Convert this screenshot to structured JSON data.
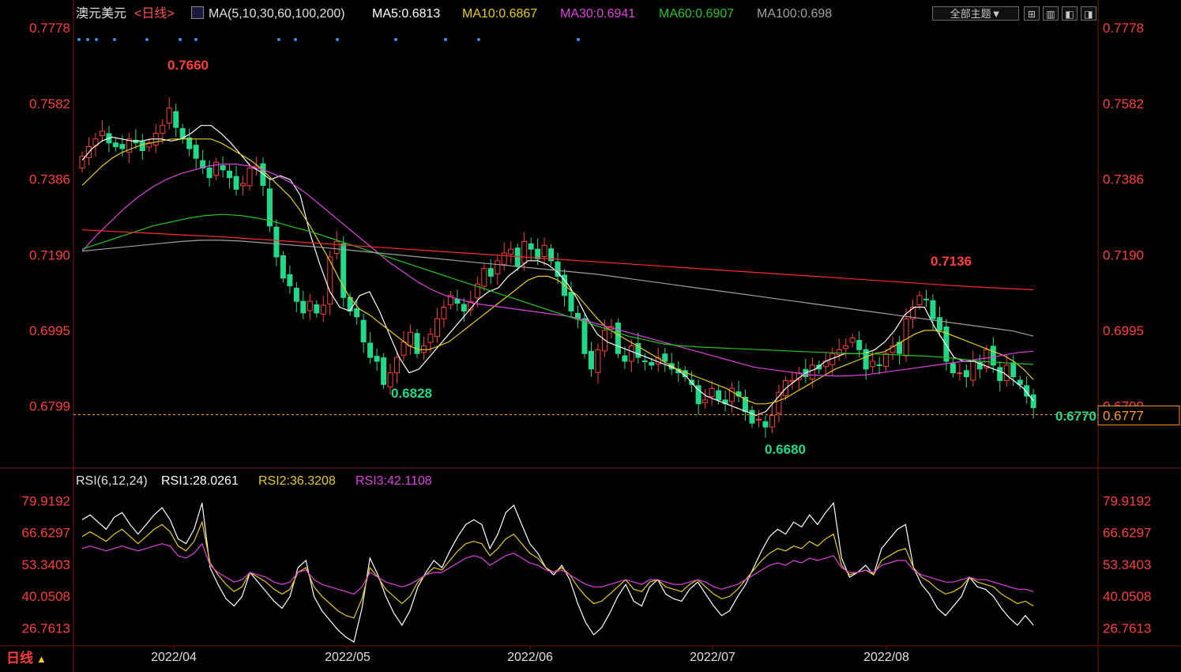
{
  "header": {
    "instrument": "澳元美元",
    "period": "<日线>",
    "ma_label": "MA(5,10,30,60,100,200)",
    "ma5": "MA5:0.6813",
    "ma10": "MA10:0.6867",
    "ma30": "MA30:0.6941",
    "ma60": "MA60:0.6907",
    "ma100": "MA100:0.698",
    "theme_button": "全部主题▼"
  },
  "rsi_header": {
    "label": "RSI(6,12,24)",
    "rsi1": "RSI1:28.0261",
    "rsi2": "RSI2:36.3208",
    "rsi3": "RSI3:42.1108"
  },
  "footer": {
    "period_badge": "日线",
    "badge_arrow": "▲"
  },
  "colors": {
    "background": "#000000",
    "up": "#ff3c3c",
    "down": "#22d98a",
    "ma5": "#ffffff",
    "ma10": "#e6cc1a",
    "ma30": "#e040e0",
    "ma60": "#22c422",
    "ma100": "#a0a0a0",
    "ma200": "#ff2a2a",
    "grid": "#7a1414",
    "axis_text": "#ff3c3c"
  },
  "chart_data": [
    {
      "type": "candlestick",
      "title": "",
      "y_ticks": [
        "0.7778",
        "0.7582",
        "0.7386",
        "0.7190",
        "0.6995",
        "0.6799"
      ],
      "ylim": [
        0.6645,
        0.7778
      ],
      "x_ticks": [
        "2022/04",
        "2022/05",
        "2022/06",
        "2022/07",
        "2022/08"
      ],
      "annotations": {
        "high": "0.7660",
        "low_may": "0.6828",
        "low_jul": "0.6680",
        "high_aug": "0.7136",
        "last_low": "0.6770",
        "current_price": "0.6777"
      },
      "current_price": 0.6777,
      "close_series": [
        0.7445,
        0.747,
        0.749,
        0.751,
        0.748,
        0.747,
        0.7465,
        0.749,
        0.748,
        0.746,
        0.748,
        0.7505,
        0.7525,
        0.757,
        0.752,
        0.749,
        0.7465,
        0.744,
        0.7415,
        0.739,
        0.743,
        0.741,
        0.739,
        0.736,
        0.7375,
        0.7415,
        0.742,
        0.737,
        0.7265,
        0.7185,
        0.713,
        0.711,
        0.707,
        0.704,
        0.707,
        0.704,
        0.706,
        0.7185,
        0.7225,
        0.708,
        0.7045,
        0.703,
        0.6965,
        0.6925,
        0.6915,
        0.6855,
        0.6885,
        0.6925,
        0.6965,
        0.699,
        0.6935,
        0.6955,
        0.6985,
        0.7025,
        0.7055,
        0.7085,
        0.7065,
        0.7045,
        0.707,
        0.7115,
        0.7155,
        0.7135,
        0.7175,
        0.7195,
        0.7205,
        0.716,
        0.7225,
        0.7205,
        0.718,
        0.7215,
        0.7175,
        0.7135,
        0.7085,
        0.7045,
        0.7025,
        0.6935,
        0.6895,
        0.6945,
        0.6995,
        0.7005,
        0.6935,
        0.6915,
        0.6955,
        0.6925,
        0.6915,
        0.6905,
        0.6925,
        0.6915,
        0.6895,
        0.6885,
        0.6875,
        0.6855,
        0.6805,
        0.6815,
        0.6845,
        0.6815,
        0.6805,
        0.6845,
        0.6825,
        0.6785,
        0.6755,
        0.6765,
        0.6745,
        0.6775,
        0.6835,
        0.6865,
        0.6865,
        0.6885,
        0.6875,
        0.6905,
        0.6895,
        0.6915,
        0.6935,
        0.6945,
        0.6955,
        0.6975,
        0.6945,
        0.6895,
        0.6915,
        0.6905,
        0.6935,
        0.6955,
        0.6935,
        0.7025,
        0.7055,
        0.7085,
        0.7075,
        0.7025,
        0.6995,
        0.6915,
        0.6885,
        0.6885,
        0.6875,
        0.6915,
        0.6895,
        0.6945,
        0.6905,
        0.6865,
        0.6905,
        0.6875,
        0.6855,
        0.6825,
        0.6795
      ],
      "series": [
        {
          "name": "MA5",
          "values": [
            0.7435,
            0.7465,
            0.7485,
            0.7495,
            0.749,
            0.7485,
            0.7485,
            0.749,
            0.749,
            0.7485,
            0.749,
            0.7505,
            0.7525,
            0.7525,
            0.7505,
            0.748,
            0.745,
            0.742,
            0.7405,
            0.7385,
            0.7395,
            0.7385,
            0.7345,
            0.7245,
            0.7165,
            0.7095,
            0.7055,
            0.7045,
            0.7085,
            0.7095,
            0.7045,
            0.6985,
            0.6925,
            0.6885,
            0.6895,
            0.6925,
            0.6955,
            0.6985,
            0.7015,
            0.7045,
            0.7075,
            0.7095,
            0.7105,
            0.7135,
            0.7155,
            0.7175,
            0.7175,
            0.7165,
            0.7145,
            0.7115,
            0.7075,
            0.7025,
            0.6985,
            0.6965,
            0.6955,
            0.6945,
            0.6935,
            0.6925,
            0.6915,
            0.6905,
            0.6895,
            0.6875,
            0.6845,
            0.6825,
            0.6815,
            0.6805,
            0.6795,
            0.6785,
            0.6775,
            0.6785,
            0.6815,
            0.6845,
            0.6865,
            0.6885,
            0.6895,
            0.6915,
            0.6925,
            0.6935,
            0.6935,
            0.6935,
            0.6945,
            0.6965,
            0.6995,
            0.7035,
            0.7055,
            0.7055,
            0.7005,
            0.6965,
            0.6925,
            0.6915,
            0.6915,
            0.6905,
            0.6895,
            0.6885,
            0.6865,
            0.6845,
            0.6813
          ]
        },
        {
          "name": "MA10",
          "values": [
            0.737,
            0.7395,
            0.742,
            0.744,
            0.7455,
            0.7465,
            0.7475,
            0.748,
            0.7485,
            0.749,
            0.749,
            0.749,
            0.749,
            0.749,
            0.748,
            0.7465,
            0.745,
            0.7435,
            0.7415,
            0.739,
            0.7365,
            0.734,
            0.7305,
            0.7265,
            0.722,
            0.7175,
            0.7125,
            0.708,
            0.705,
            0.7035,
            0.7015,
            0.6995,
            0.6975,
            0.6955,
            0.6945,
            0.6945,
            0.6955,
            0.6965,
            0.6985,
            0.7005,
            0.7025,
            0.7045,
            0.7065,
            0.7085,
            0.7105,
            0.7125,
            0.7135,
            0.7135,
            0.7125,
            0.7105,
            0.7085,
            0.7055,
            0.7025,
            0.7,
            0.6985,
            0.697,
            0.6955,
            0.694,
            0.6925,
            0.691,
            0.6895,
            0.6885,
            0.6875,
            0.6865,
            0.6855,
            0.6845,
            0.683,
            0.6815,
            0.6805,
            0.6805,
            0.681,
            0.682,
            0.6835,
            0.685,
            0.6865,
            0.688,
            0.6895,
            0.6905,
            0.6915,
            0.6925,
            0.6935,
            0.694,
            0.6955,
            0.697,
            0.6985,
            0.6995,
            0.6995,
            0.699,
            0.698,
            0.697,
            0.696,
            0.695,
            0.694,
            0.693,
            0.6915,
            0.6895,
            0.6867
          ]
        },
        {
          "name": "MA30",
          "values": [
            0.72,
            0.724,
            0.7275,
            0.731,
            0.734,
            0.7365,
            0.7385,
            0.74,
            0.741,
            0.742,
            0.7425,
            0.7425,
            0.742,
            0.741,
            0.7395,
            0.7375,
            0.735,
            0.732,
            0.729,
            0.726,
            0.723,
            0.72,
            0.717,
            0.7145,
            0.712,
            0.71,
            0.7085,
            0.7075,
            0.7065,
            0.706,
            0.7055,
            0.705,
            0.7045,
            0.704,
            0.7035,
            0.703,
            0.702,
            0.701,
            0.7,
            0.699,
            0.698,
            0.697,
            0.696,
            0.695,
            0.694,
            0.693,
            0.692,
            0.691,
            0.69,
            0.6895,
            0.689,
            0.6885,
            0.688,
            0.6878,
            0.6877,
            0.6878,
            0.688,
            0.6885,
            0.689,
            0.6895,
            0.69,
            0.6905,
            0.691,
            0.6915,
            0.692,
            0.6925,
            0.6932,
            0.6938,
            0.6941
          ]
        },
        {
          "name": "MA60",
          "values": [
            0.7205,
            0.722,
            0.7235,
            0.725,
            0.7265,
            0.7275,
            0.7285,
            0.7292,
            0.7295,
            0.7292,
            0.7285,
            0.7275,
            0.7262,
            0.725,
            0.7235,
            0.722,
            0.7205,
            0.719,
            0.7175,
            0.716,
            0.7145,
            0.713,
            0.7115,
            0.71,
            0.7085,
            0.707,
            0.7055,
            0.704,
            0.7025,
            0.701,
            0.6995,
            0.698,
            0.697,
            0.696,
            0.6955,
            0.6952,
            0.695,
            0.6948,
            0.6946,
            0.6944,
            0.6942,
            0.694,
            0.6938,
            0.6936,
            0.6935,
            0.6934,
            0.6932,
            0.693,
            0.6928,
            0.6925,
            0.692,
            0.6915,
            0.6912,
            0.6909,
            0.6907
          ]
        },
        {
          "name": "MA100",
          "values": [
            0.72,
            0.7205,
            0.721,
            0.7215,
            0.722,
            0.7225,
            0.7228,
            0.7228,
            0.7226,
            0.7222,
            0.7218,
            0.7214,
            0.721,
            0.7205,
            0.72,
            0.7195,
            0.719,
            0.7185,
            0.718,
            0.7175,
            0.717,
            0.7165,
            0.716,
            0.7155,
            0.715,
            0.7145,
            0.714,
            0.7133,
            0.7126,
            0.7119,
            0.7112,
            0.7105,
            0.7098,
            0.7091,
            0.7084,
            0.7077,
            0.707,
            0.7063,
            0.7056,
            0.7049,
            0.7042,
            0.7035,
            0.7028,
            0.7021,
            0.7014,
            0.7007,
            0.7,
            0.6993,
            0.698
          ]
        },
        {
          "name": "MA200",
          "values": [
            0.7255,
            0.7252,
            0.7249,
            0.7246,
            0.7243,
            0.724,
            0.7237,
            0.7233,
            0.7229,
            0.7225,
            0.7221,
            0.7217,
            0.7213,
            0.7209,
            0.7205,
            0.7201,
            0.7197,
            0.7193,
            0.7189,
            0.7185,
            0.7181,
            0.7177,
            0.7173,
            0.7169,
            0.7165,
            0.7161,
            0.7157,
            0.7153,
            0.7149,
            0.7145,
            0.7141,
            0.7137,
            0.7133,
            0.7129,
            0.7125,
            0.7121,
            0.7117,
            0.7113,
            0.7109,
            0.7106,
            0.7103,
            0.71
          ]
        }
      ]
    },
    {
      "type": "line",
      "title": "",
      "y_ticks": [
        "79.9192",
        "66.6297",
        "53.3403",
        "40.0508",
        "26.7613"
      ],
      "ylim": [
        20.0,
        85.0
      ],
      "series": [
        {
          "name": "RSI1",
          "values": [
            72,
            74,
            71,
            68,
            73,
            75,
            70,
            66,
            70,
            74,
            77,
            72,
            64,
            62,
            68,
            79,
            52,
            45,
            39,
            36,
            40,
            50,
            46,
            42,
            38,
            35,
            40,
            52,
            55,
            40,
            34,
            30,
            26,
            23,
            21,
            35,
            56,
            49,
            40,
            33,
            28,
            34,
            44,
            50,
            55,
            52,
            59,
            65,
            70,
            72,
            70,
            60,
            66,
            75,
            78,
            70,
            62,
            58,
            52,
            49,
            53,
            47,
            37,
            29,
            24,
            27,
            33,
            40,
            45,
            38,
            36,
            44,
            47,
            41,
            39,
            38,
            43,
            46,
            41,
            36,
            32,
            34,
            40,
            45,
            52,
            59,
            65,
            68,
            66,
            71,
            69,
            74,
            70,
            75,
            79,
            56,
            48,
            50,
            53,
            49,
            60,
            64,
            68,
            70,
            52,
            45,
            41,
            35,
            32,
            36,
            40,
            48,
            44,
            43,
            40,
            35,
            31,
            28,
            32,
            28
          ]
        },
        {
          "name": "RSI2",
          "values": [
            65,
            67,
            65,
            63,
            66,
            68,
            65,
            62,
            65,
            68,
            70,
            67,
            61,
            59,
            63,
            71,
            54,
            49,
            45,
            42,
            44,
            50,
            48,
            46,
            43,
            41,
            43,
            50,
            52,
            44,
            40,
            37,
            34,
            32,
            31,
            39,
            52,
            48,
            43,
            40,
            37,
            40,
            46,
            49,
            52,
            51,
            55,
            59,
            62,
            63,
            62,
            57,
            60,
            64,
            66,
            62,
            58,
            56,
            52,
            50,
            52,
            49,
            44,
            40,
            37,
            38,
            41,
            44,
            47,
            43,
            42,
            46,
            47,
            44,
            43,
            42,
            45,
            47,
            44,
            41,
            39,
            40,
            43,
            47,
            51,
            55,
            58,
            60,
            59,
            61,
            60,
            63,
            61,
            64,
            66,
            53,
            49,
            50,
            51,
            49,
            55,
            57,
            59,
            60,
            52,
            48,
            46,
            43,
            41,
            42,
            44,
            48,
            46,
            45,
            44,
            41,
            39,
            37,
            38,
            36
          ]
        },
        {
          "name": "RSI3",
          "values": [
            60,
            61,
            60,
            59,
            60,
            61,
            60,
            59,
            60,
            61,
            62,
            61,
            57,
            56,
            58,
            62,
            53,
            50,
            48,
            46,
            47,
            50,
            49,
            48,
            46,
            45,
            46,
            50,
            51,
            47,
            45,
            44,
            43,
            42,
            41,
            44,
            50,
            48,
            46,
            45,
            44,
            45,
            47,
            49,
            50,
            50,
            52,
            54,
            56,
            57,
            56,
            53,
            55,
            57,
            58,
            56,
            54,
            53,
            51,
            50,
            51,
            49,
            47,
            45,
            44,
            44,
            45,
            46,
            47,
            46,
            45,
            47,
            47,
            46,
            45,
            45,
            46,
            47,
            46,
            44,
            43,
            44,
            45,
            47,
            49,
            51,
            53,
            54,
            53,
            55,
            54,
            56,
            55,
            56,
            57,
            52,
            50,
            50,
            51,
            50,
            53,
            54,
            55,
            55,
            51,
            49,
            48,
            47,
            46,
            46,
            47,
            48,
            47,
            47,
            46,
            45,
            44,
            43,
            43,
            42
          ]
        }
      ]
    }
  ]
}
